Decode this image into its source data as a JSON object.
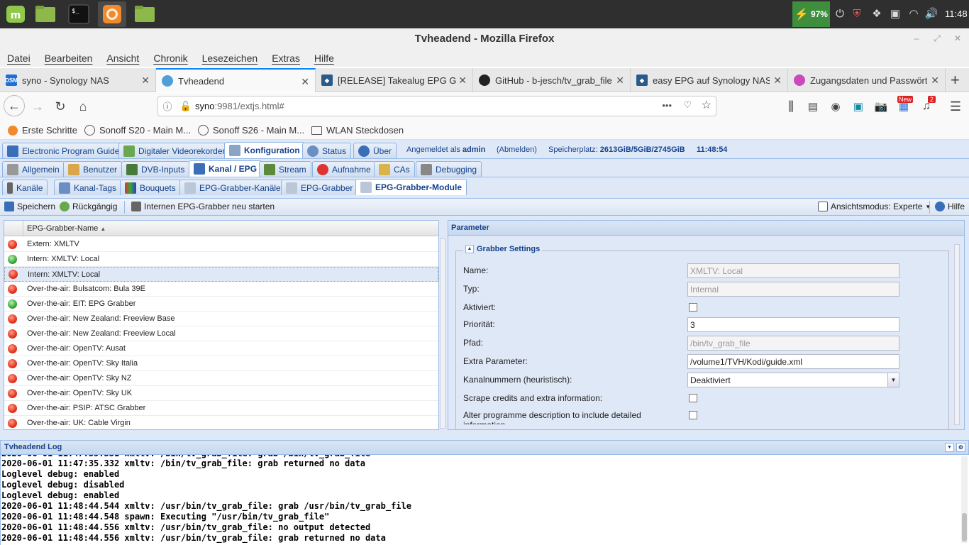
{
  "taskbar": {
    "battery": "97%",
    "clock": "11:48"
  },
  "window": {
    "title": "Tvheadend - Mozilla Firefox"
  },
  "menu": [
    "Datei",
    "Bearbeiten",
    "Ansicht",
    "Chronik",
    "Lesezeichen",
    "Extras",
    "Hilfe"
  ],
  "tabs": [
    {
      "label": "syno - Synology NAS",
      "favicon": "DSM"
    },
    {
      "label": "Tvheadend",
      "favicon": "tvh"
    },
    {
      "label": "[RELEASE] Takealug EPG Grab",
      "favicon": "kodi"
    },
    {
      "label": "GitHub - b-jesch/tv_grab_file",
      "favicon": "github"
    },
    {
      "label": "easy EPG auf Synology NAS -",
      "favicon": "kodi"
    },
    {
      "label": "Zugangsdaten und Passwört",
      "favicon": "web"
    }
  ],
  "url": {
    "host": "syno",
    "rest": ":9981/extjs.html#"
  },
  "extensions": {
    "new_badge": "New",
    "count_badge": "2"
  },
  "bookmarks": [
    "Erste Schritte",
    "Sonoff S20 - Main M...",
    "Sonoff S26 - Main M...",
    "WLAN Steckdosen"
  ],
  "tvh": {
    "main_tabs": [
      "Electronic Program Guide",
      "Digitaler Videorekorder",
      "Konfiguration",
      "Status",
      "Über"
    ],
    "login": {
      "prefix": "Angemeldet als",
      "user": "admin",
      "logout": "(Abmelden)"
    },
    "storage": {
      "label": "Speicherplatz:",
      "value": "2613GiB/5GiB/2745GiB"
    },
    "time": "11:48:54",
    "config_tabs": [
      "Allgemein",
      "Benutzer",
      "DVB-Inputs",
      "Kanal / EPG",
      "Stream",
      "Aufnahme",
      "CAs",
      "Debugging"
    ],
    "epg_tabs": [
      "Kanäle",
      "Kanal-Tags",
      "Bouquets",
      "EPG-Grabber-Kanäle",
      "EPG-Grabber",
      "EPG-Grabber-Module"
    ],
    "toolbar": {
      "save": "Speichern",
      "undo": "Rückgängig",
      "restart": "Internen EPG-Grabber neu starten",
      "view_mode": "Ansichtsmodus: Experte",
      "help": "Hilfe"
    },
    "grid": {
      "column": "EPG-Grabber-Name",
      "rows": [
        {
          "name": "Extern: XMLTV",
          "status": "red"
        },
        {
          "name": "Intern: XMLTV: Local",
          "status": "green"
        },
        {
          "name": "Intern: XMLTV: Local",
          "status": "red",
          "selected": true
        },
        {
          "name": "Over-the-air: Bulsatcom: Bula 39E",
          "status": "red"
        },
        {
          "name": "Over-the-air: EIT: EPG Grabber",
          "status": "green"
        },
        {
          "name": "Over-the-air: New Zealand: Freeview Base",
          "status": "red"
        },
        {
          "name": "Over-the-air: New Zealand: Freeview Local",
          "status": "red"
        },
        {
          "name": "Over-the-air: OpenTV: Ausat",
          "status": "red"
        },
        {
          "name": "Over-the-air: OpenTV: Sky Italia",
          "status": "red"
        },
        {
          "name": "Over-the-air: OpenTV: Sky NZ",
          "status": "red"
        },
        {
          "name": "Over-the-air: OpenTV: Sky UK",
          "status": "red"
        },
        {
          "name": "Over-the-air: PSIP: ATSC Grabber",
          "status": "red"
        },
        {
          "name": "Over-the-air: UK: Cable Virgin",
          "status": "red"
        }
      ]
    },
    "params": {
      "title": "Parameter",
      "section": "Grabber Settings",
      "fields": {
        "name": {
          "label": "Name:",
          "value": "XMLTV: Local"
        },
        "type": {
          "label": "Typ:",
          "value": "Internal"
        },
        "enabled": {
          "label": "Aktiviert:"
        },
        "priority": {
          "label": "Priorität:",
          "value": "3"
        },
        "path": {
          "label": "Pfad:",
          "value": "/bin/tv_grab_file"
        },
        "extra": {
          "label": "Extra Parameter:",
          "value": "/volume1/TVH/Kodi/guide.xml"
        },
        "channel_numbers": {
          "label": "Kanalnummern (heuristisch):",
          "value": "Deaktiviert"
        },
        "scrape": {
          "label": "Scrape credits and extra information:"
        },
        "alter": {
          "label": "Alter programme description to include detailed",
          "label2": "information"
        }
      }
    },
    "log": {
      "title": "Tvheadend Log",
      "lines": [
        "2020-06-01 11:47:35.332 xmltv: /bin/tv_grab_file: grab returned no data",
        "Loglevel debug: enabled",
        "Loglevel debug: disabled",
        "Loglevel debug: enabled",
        "2020-06-01 11:48:44.544 xmltv: /usr/bin/tv_grab_file: grab /usr/bin/tv_grab_file",
        "2020-06-01 11:48:44.548 spawn: Executing \"/usr/bin/tv_grab_file\"",
        "2020-06-01 11:48:44.556 xmltv: /usr/bin/tv_grab_file: no output detected",
        "2020-06-01 11:48:44.556 xmltv: /usr/bin/tv_grab_file: grab returned no data"
      ]
    }
  },
  "colors": {
    "accent": "#15428b",
    "panel": "#dfe8f6",
    "border": "#99bbe8",
    "status_red": "#e5331b",
    "status_green": "#3aa53a"
  }
}
